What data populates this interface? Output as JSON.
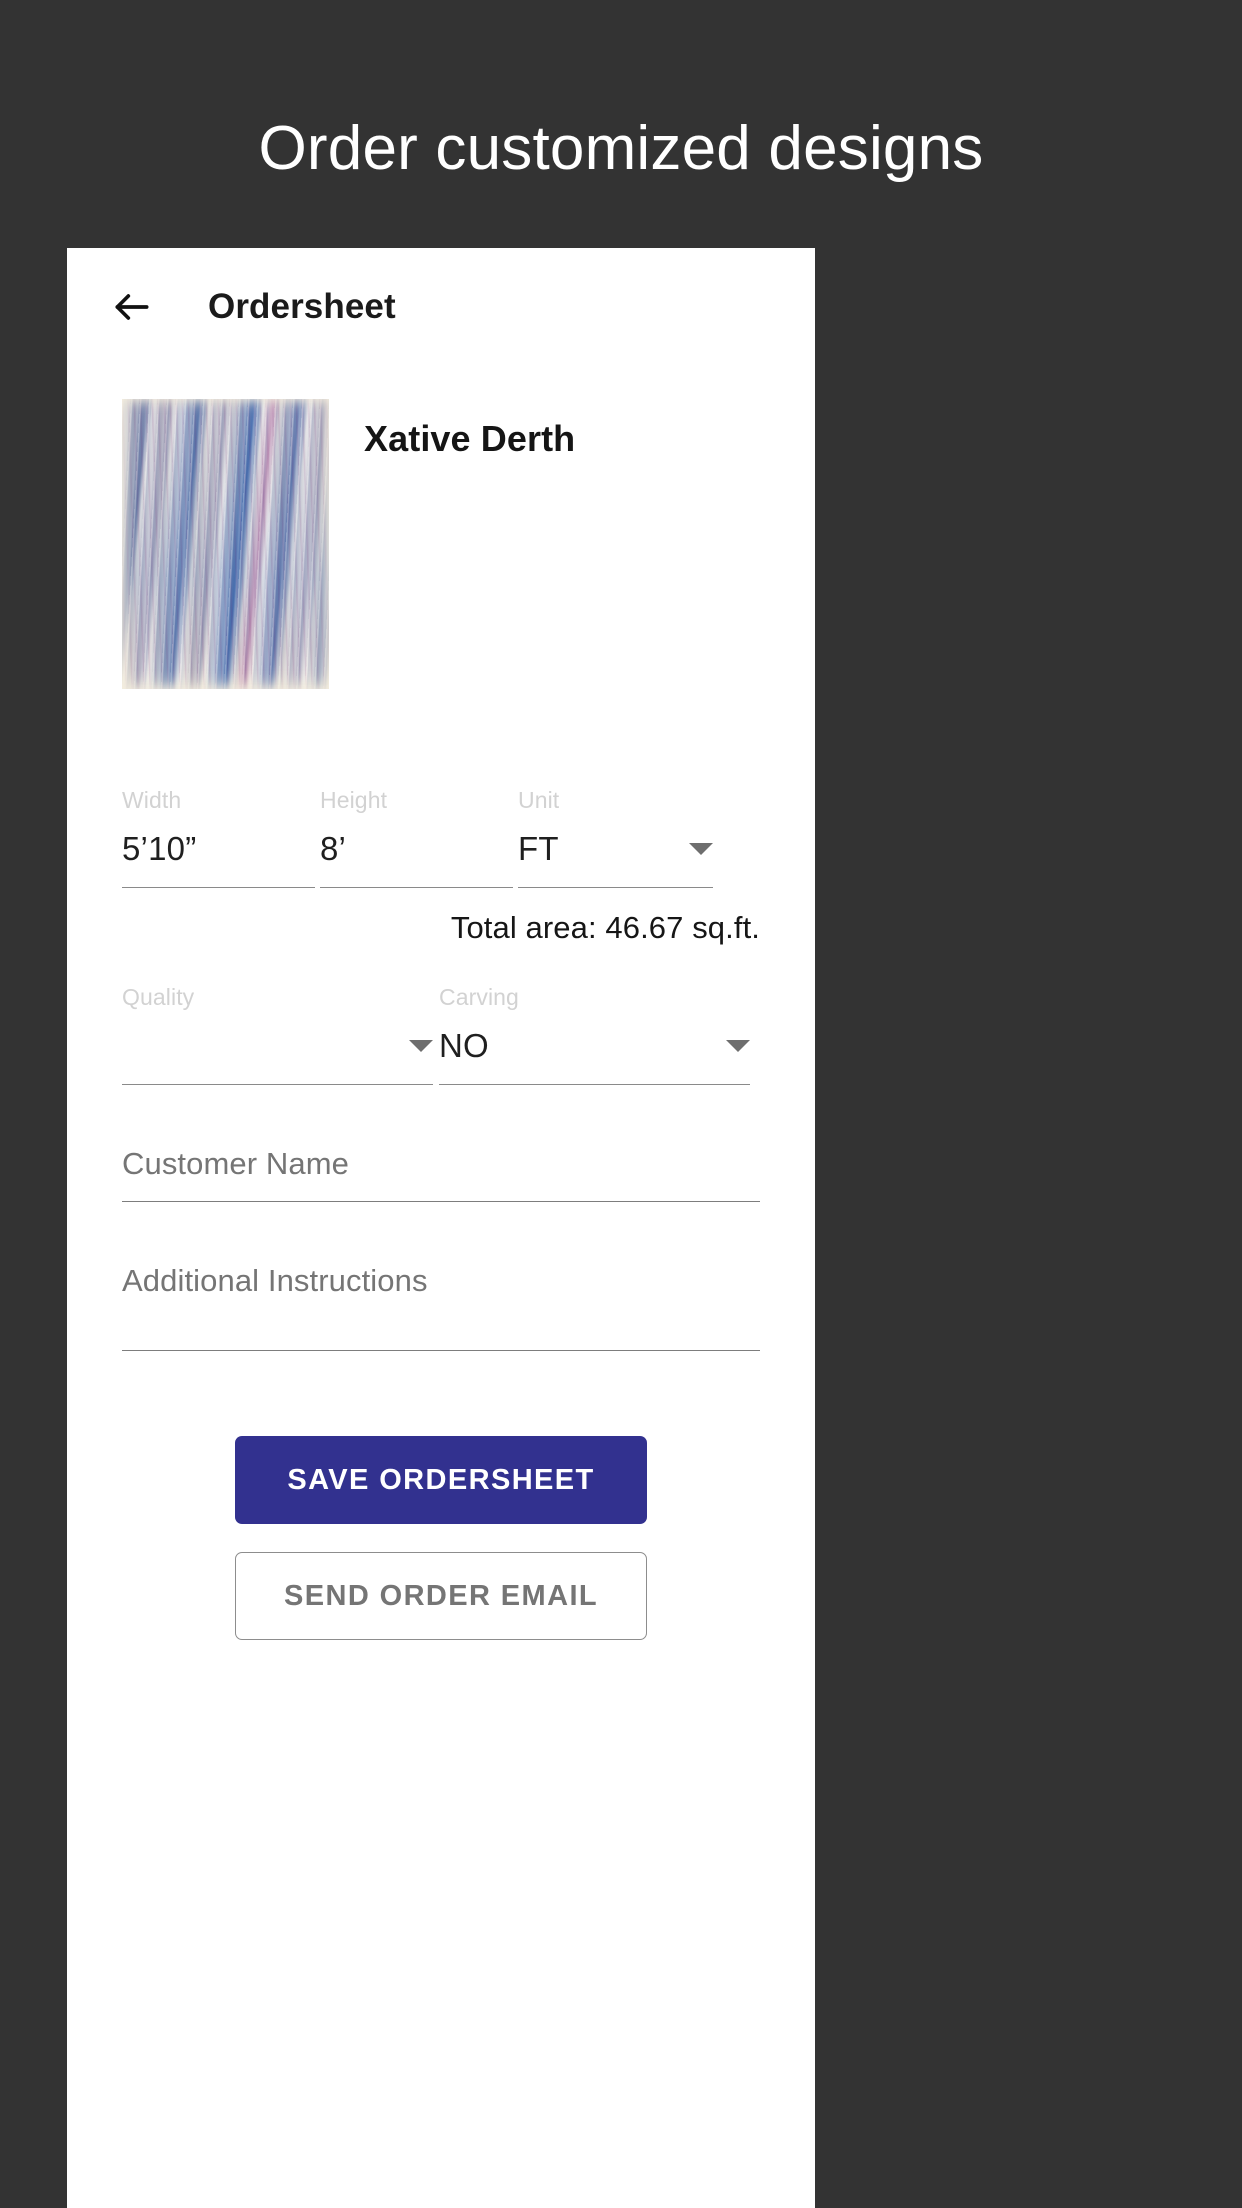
{
  "promo": {
    "headline": "Order customized designs"
  },
  "appbar": {
    "back_icon": "arrow-left-icon",
    "title": "Ordersheet"
  },
  "product": {
    "name": "Xative Derth",
    "image_alt": "abstract-blue-purple-brushstroke-painting"
  },
  "dimensions": {
    "width": {
      "label": "Width",
      "value": "5’10”"
    },
    "height": {
      "label": "Height",
      "value": "8’"
    },
    "unit": {
      "label": "Unit",
      "value": "FT",
      "caret_icon": "chevron-down-icon"
    }
  },
  "total_area": "Total area: 46.67 sq.ft.",
  "options": {
    "quality": {
      "label": "Quality",
      "value": "",
      "caret_icon": "chevron-down-icon"
    },
    "carving": {
      "label": "Carving",
      "value": "NO",
      "caret_icon": "chevron-down-icon"
    }
  },
  "inputs": {
    "customer_name": {
      "placeholder": "Customer Name",
      "value": ""
    },
    "additional_instructions": {
      "placeholder": "Additional Instructions",
      "value": ""
    }
  },
  "buttons": {
    "save": "SAVE ORDERSHEET",
    "send_email": "SEND ORDER EMAIL"
  },
  "colors": {
    "background": "#333333",
    "card": "#ffffff",
    "primary": "#32318f",
    "label_muted": "#d2d2d2",
    "placeholder": "#757575",
    "underline": "#8a8a8a"
  }
}
